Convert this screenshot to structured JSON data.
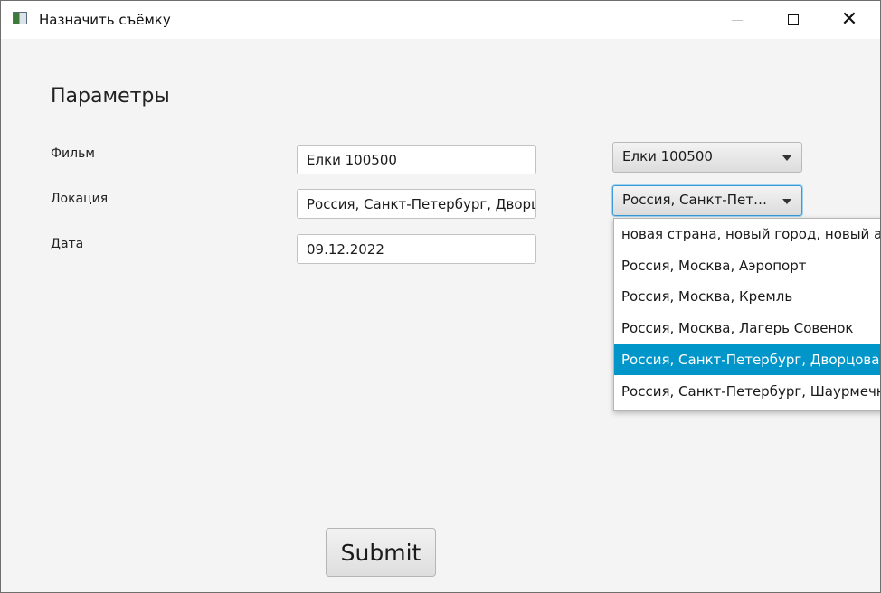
{
  "window": {
    "title": "Назначить съёмку"
  },
  "form": {
    "heading": "Параметры",
    "film_label": "Фильм",
    "location_label": "Локация",
    "date_label": "Дата",
    "film_value": "Елки 100500",
    "location_value": "Россия, Санкт-Петербург, Дворцовая",
    "date_value": "09.12.2022",
    "film_combo_value": "Елки 100500",
    "location_combo_value": "Россия, Санкт-Петербург, Дворцовая",
    "submit_label": "Submit"
  },
  "location_options": [
    {
      "label": "новая страна, новый город, новый адрес",
      "selected": false
    },
    {
      "label": "Россия, Москва, Аэропорт",
      "selected": false
    },
    {
      "label": "Россия, Москва, Кремль",
      "selected": false
    },
    {
      "label": "Россия, Москва, Лагерь Совенок",
      "selected": false
    },
    {
      "label": "Россия, Санкт-Петербург, Дворцовая",
      "selected": true
    },
    {
      "label": "Россия, Санкт-Петербург, Шаурмечная",
      "selected": false
    }
  ],
  "colors": {
    "selection": "#0096c9",
    "focus_ring": "#3a9bd6",
    "window_bg": "#f4f4f4"
  }
}
